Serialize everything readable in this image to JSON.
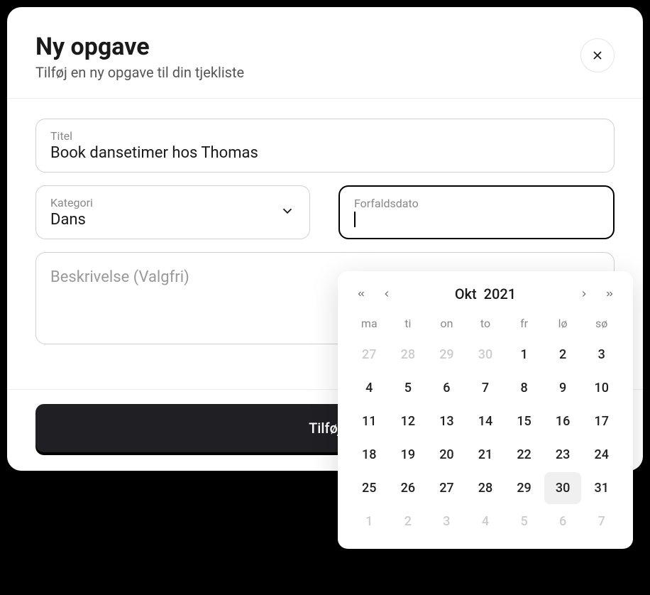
{
  "modal": {
    "title": "Ny opgave",
    "subtitle": "Tilføj en ny opgave til din tjekliste"
  },
  "fields": {
    "title": {
      "label": "Titel",
      "value": "Book dansetimer hos Thomas"
    },
    "category": {
      "label": "Kategori",
      "value": "Dans"
    },
    "dueDate": {
      "label": "Forfaldsdato",
      "value": ""
    },
    "description": {
      "placeholder": "Beskrivelse (Valgfri)"
    }
  },
  "submit": {
    "label": "Tilføj"
  },
  "datepicker": {
    "month": "Okt",
    "year": "2021",
    "dow": [
      "ma",
      "ti",
      "on",
      "to",
      "fr",
      "lø",
      "sø"
    ],
    "weeks": [
      [
        {
          "d": 27,
          "o": true
        },
        {
          "d": 28,
          "o": true
        },
        {
          "d": 29,
          "o": true
        },
        {
          "d": 30,
          "o": true
        },
        {
          "d": 1
        },
        {
          "d": 2
        },
        {
          "d": 3
        }
      ],
      [
        {
          "d": 4
        },
        {
          "d": 5
        },
        {
          "d": 6
        },
        {
          "d": 7
        },
        {
          "d": 8
        },
        {
          "d": 9
        },
        {
          "d": 10
        }
      ],
      [
        {
          "d": 11
        },
        {
          "d": 12
        },
        {
          "d": 13
        },
        {
          "d": 14
        },
        {
          "d": 15
        },
        {
          "d": 16
        },
        {
          "d": 17
        }
      ],
      [
        {
          "d": 18
        },
        {
          "d": 19
        },
        {
          "d": 20
        },
        {
          "d": 21
        },
        {
          "d": 22
        },
        {
          "d": 23
        },
        {
          "d": 24
        }
      ],
      [
        {
          "d": 25
        },
        {
          "d": 26
        },
        {
          "d": 27
        },
        {
          "d": 28
        },
        {
          "d": 29
        },
        {
          "d": 30,
          "hover": true
        },
        {
          "d": 31
        }
      ],
      [
        {
          "d": 1,
          "o": true
        },
        {
          "d": 2,
          "o": true
        },
        {
          "d": 3,
          "o": true
        },
        {
          "d": 4,
          "o": true
        },
        {
          "d": 5,
          "o": true
        },
        {
          "d": 6,
          "o": true
        },
        {
          "d": 7,
          "o": true
        }
      ]
    ]
  }
}
